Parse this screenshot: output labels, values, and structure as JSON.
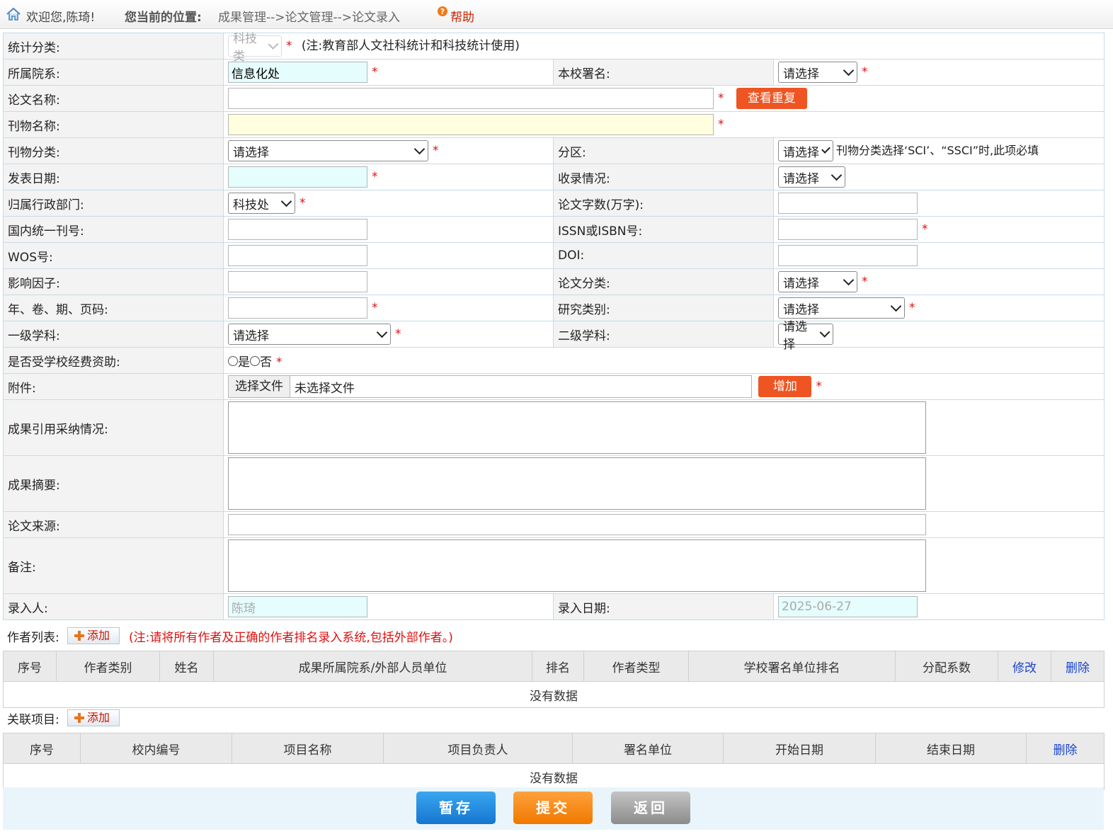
{
  "topbar": {
    "welcome": "欢迎您,陈琦!",
    "location_label": "您当前的位置:",
    "location_path": "成果管理-->论文管理-->论文录入",
    "help": "帮助"
  },
  "form": {
    "stat_category": {
      "label": "统计分类:",
      "value": "科技类",
      "note": "(注:教育部人文社科统计和科技统计使用)"
    },
    "department": {
      "label": "所属院系:",
      "value": "信息化处"
    },
    "school_signature": {
      "label": "本校署名:",
      "value": "请选择"
    },
    "paper_title": {
      "label": "论文名称:",
      "value": "",
      "check_button": "查看重复"
    },
    "journal_name": {
      "label": "刊物名称:",
      "value": ""
    },
    "journal_category": {
      "label": "刊物分类:",
      "value": "请选择"
    },
    "zone": {
      "label": "分区:",
      "value": "请选择",
      "note": "刊物分类选择‘SCI’、“SSCI”时,此项必填"
    },
    "publish_date": {
      "label": "发表日期:",
      "value": ""
    },
    "indexing": {
      "label": "收录情况:",
      "value": "请选择"
    },
    "admin_dept": {
      "label": "归属行政部门:",
      "value": "科技处"
    },
    "word_count": {
      "label": "论文字数(万字):",
      "value": ""
    },
    "cn_number": {
      "label": "国内统一刊号:",
      "value": ""
    },
    "issn": {
      "label": "ISSN或ISBN号:",
      "value": ""
    },
    "wos": {
      "label": "WOS号:",
      "value": ""
    },
    "doi": {
      "label": "DOI:",
      "value": ""
    },
    "impact_factor": {
      "label": "影响因子:",
      "value": ""
    },
    "paper_class": {
      "label": "论文分类:",
      "value": "请选择"
    },
    "volume": {
      "label": "年、卷、期、页码:",
      "value": ""
    },
    "research_type": {
      "label": "研究类别:",
      "value": "请选择"
    },
    "primary_subject": {
      "label": "一级学科:",
      "value": "请选择"
    },
    "secondary_subject": {
      "label": "二级学科:",
      "value": "请选择"
    },
    "funded": {
      "label": "是否受学校经费资助:",
      "yes": "是",
      "no": "否"
    },
    "attachment": {
      "label": "附件:",
      "choose": "选择文件",
      "none": "未选择文件",
      "add": "增加"
    },
    "citation": {
      "label": "成果引用采纳情况:"
    },
    "abstract": {
      "label": "成果摘要:"
    },
    "source": {
      "label": "论文来源:"
    },
    "remarks": {
      "label": "备注:"
    },
    "entered_by": {
      "label": "录入人:",
      "value": "陈琦"
    },
    "entry_date": {
      "label": "录入日期:",
      "value": "2025-06-27"
    },
    "required_mark": "*"
  },
  "authors": {
    "label": "作者列表:",
    "add": "添加",
    "note": "(注:请将所有作者及正确的作者排名录入系统,包括外部作者。)",
    "columns": [
      "序号",
      "作者类别",
      "姓名",
      "成果所属院系/外部人员单位",
      "排名",
      "作者类型",
      "学校署名单位排名",
      "分配系数",
      "修改",
      "删除"
    ],
    "empty": "没有数据"
  },
  "projects": {
    "label": "关联项目:",
    "add": "添加",
    "columns": [
      "序号",
      "校内编号",
      "项目名称",
      "项目负责人",
      "署名单位",
      "开始日期",
      "结束日期",
      "删除"
    ],
    "empty": "没有数据"
  },
  "buttons": {
    "save": "暂存",
    "submit": "提交",
    "back": "返回"
  },
  "colors": {
    "required": "#dd1111",
    "orange": "#ee5522",
    "link": "#1a44cc",
    "save": "#1f8ee6",
    "submit": "#ff8a00",
    "back": "#9a9a9a"
  }
}
